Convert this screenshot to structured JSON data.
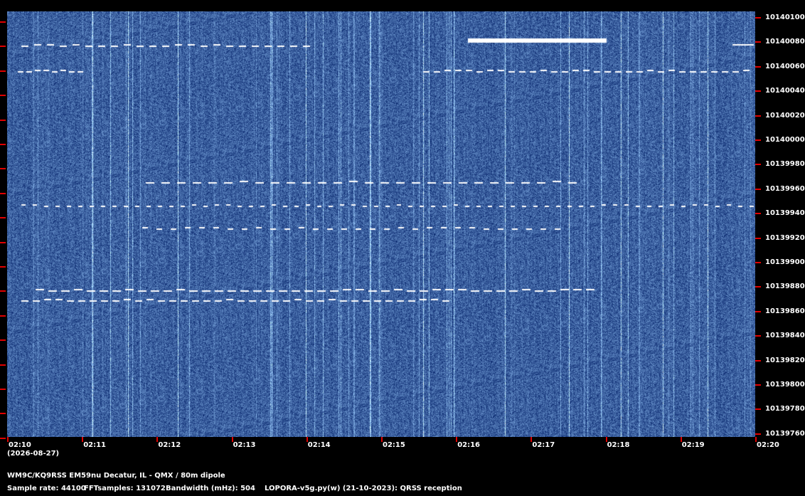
{
  "spectrogram": {
    "date": "(2026-08-27)",
    "frequency_labels": [
      "10140100",
      "10140080",
      "10140060",
      "10140040",
      "10140020",
      "10140000",
      "10139980",
      "10139960",
      "10139940",
      "10139920",
      "10139900",
      "10139880",
      "10139860",
      "10139840",
      "10139820",
      "10139800",
      "10139780",
      "10139760"
    ],
    "time_labels": [
      "02:10",
      "02:11",
      "02:12",
      "02:13",
      "02:14",
      "02:15",
      "02:16",
      "02:17",
      "02:18",
      "02:19",
      "02:20"
    ],
    "colors": {
      "background": "#000000",
      "tick": "#e00000",
      "waterfall_base": "#0b2f6e",
      "signal": "#ffffff"
    }
  },
  "footer": {
    "station": "WM9C/KQ9RSS EM59nu Decatur, IL - QMX / 80m dipole",
    "sample_rate": "Sample rate: 44100",
    "fft_samples": "FFTsamples: 131072",
    "bandwidth": "Bandwidth (mHz): 504",
    "software": "LOPORA-v5g.py(w) (21-10-2023): QRSS reception"
  }
}
